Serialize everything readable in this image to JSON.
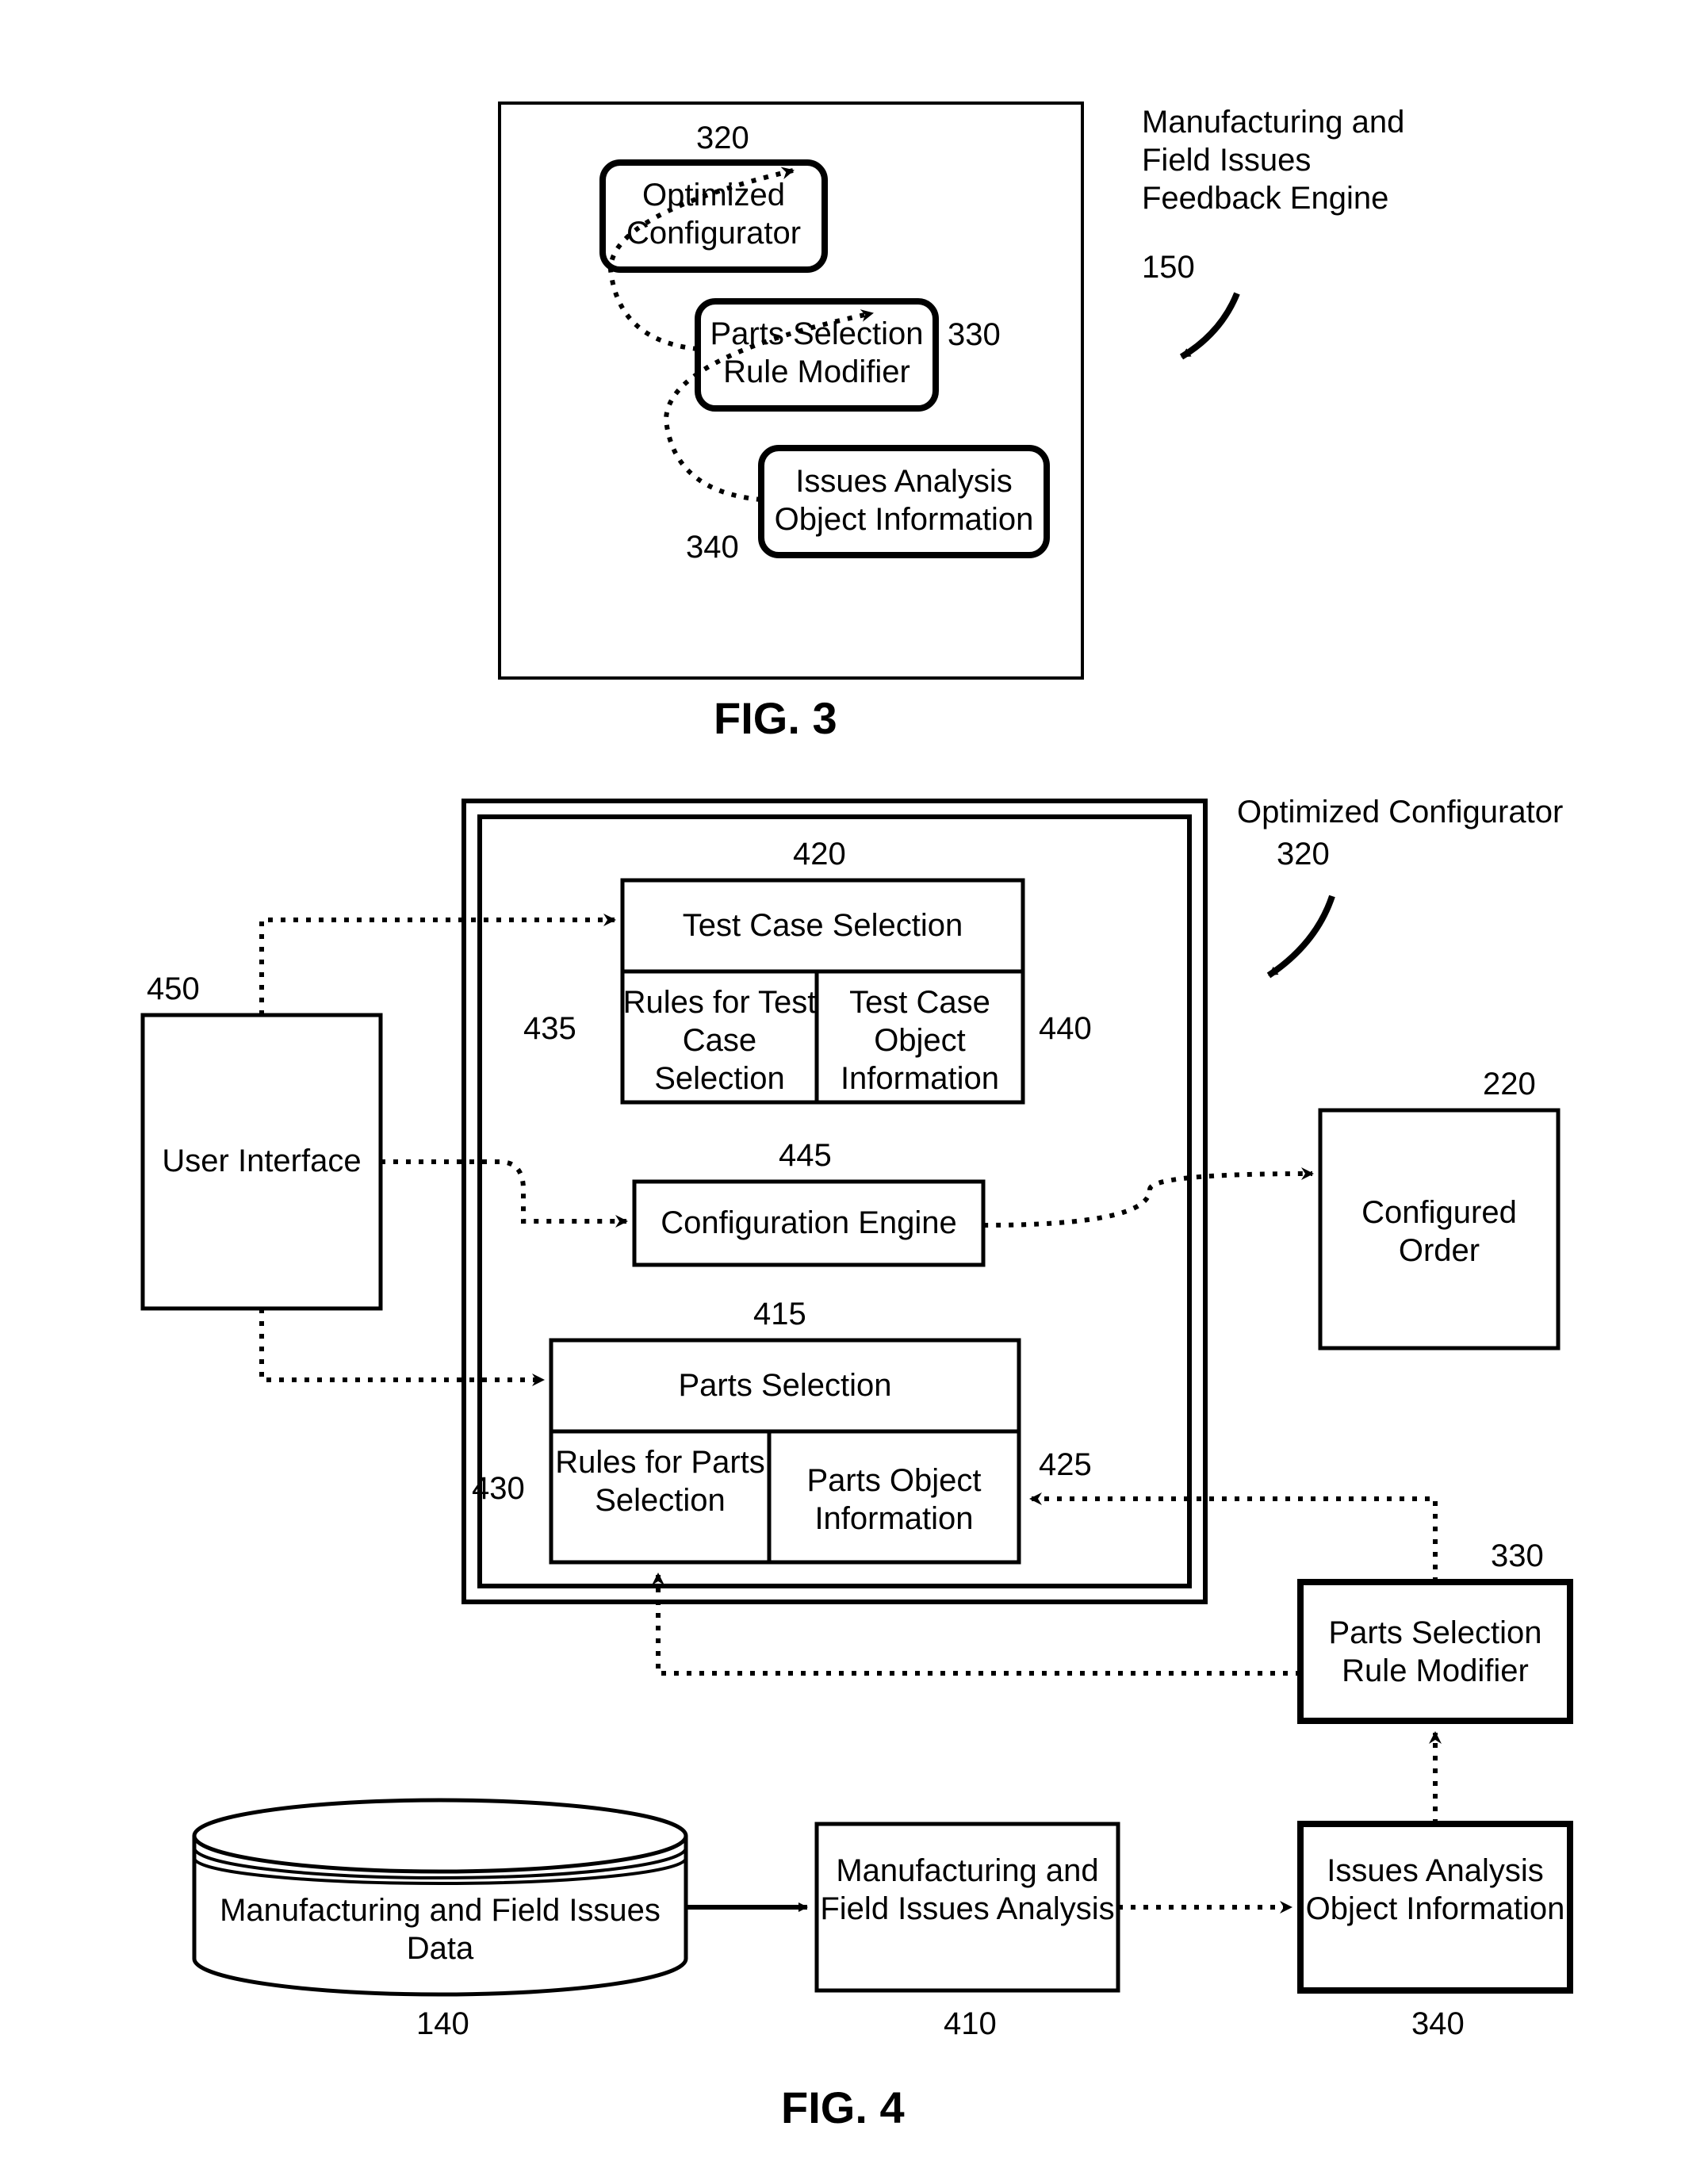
{
  "fig3": {
    "title": "FIG. 3",
    "outer_label": "Manufacturing and Field Issues Feedback Engine",
    "outer_num": "150",
    "box320": {
      "num": "320",
      "label": "Optimized Configurator"
    },
    "box330": {
      "num": "330",
      "label": "Parts Selection Rule Modifier"
    },
    "box340": {
      "num": "340",
      "label": "Issues Analysis Object Information"
    }
  },
  "fig4": {
    "title": "FIG. 4",
    "outer_label": "Optimized Configurator",
    "outer_num": "320",
    "ui": {
      "num": "450",
      "label": "User Interface"
    },
    "tcs": {
      "num": "420",
      "label": "Test Case Selection"
    },
    "tcs_rules": {
      "num": "435",
      "label": "Rules for Test Case Selection"
    },
    "tcs_obj": {
      "num": "440",
      "label": "Test Case Object Information"
    },
    "ce": {
      "num": "445",
      "label": "Configuration Engine"
    },
    "ps": {
      "num": "415",
      "label": "Parts Selection"
    },
    "ps_rules": {
      "num": "430",
      "label": "Rules for Parts Selection"
    },
    "ps_obj": {
      "num": "425",
      "label": "Parts Object Information"
    },
    "co": {
      "num": "220",
      "label": "Configured Order"
    },
    "psrm": {
      "num": "330",
      "label": "Parts Selection Rule Modifier"
    },
    "iaoi": {
      "num": "340",
      "label": "Issues Analysis Object Information"
    },
    "mfia": {
      "num": "410",
      "label": "Manufacturing and Field Issues Analysis"
    },
    "db": {
      "num": "140",
      "label": "Manufacturing and Field Issues Data"
    }
  }
}
